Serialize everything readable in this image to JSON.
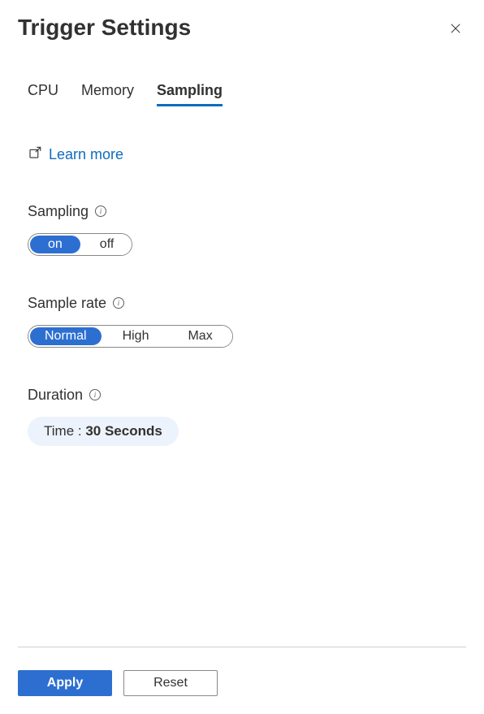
{
  "header": {
    "title": "Trigger Settings"
  },
  "tabs": {
    "items": [
      {
        "label": "CPU",
        "active": false
      },
      {
        "label": "Memory",
        "active": false
      },
      {
        "label": "Sampling",
        "active": true
      }
    ]
  },
  "learn_more": {
    "label": "Learn more"
  },
  "sampling": {
    "label": "Sampling",
    "options": [
      {
        "label": "on",
        "selected": true
      },
      {
        "label": "off",
        "selected": false
      }
    ]
  },
  "sample_rate": {
    "label": "Sample rate",
    "options": [
      {
        "label": "Normal",
        "selected": true
      },
      {
        "label": "High",
        "selected": false
      },
      {
        "label": "Max",
        "selected": false
      }
    ]
  },
  "duration": {
    "label": "Duration",
    "prefix": "Time : ",
    "value": "30 Seconds"
  },
  "footer": {
    "apply": "Apply",
    "reset": "Reset"
  }
}
